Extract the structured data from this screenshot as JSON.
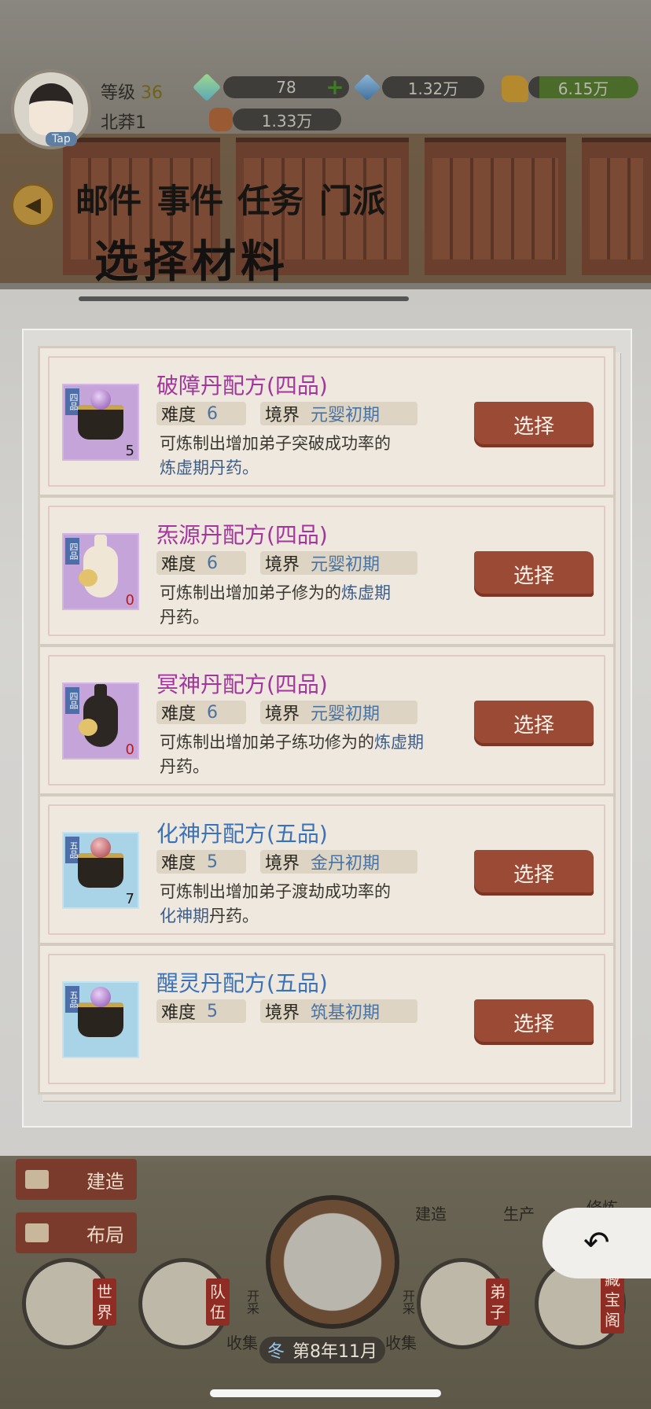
{
  "status_bar": {
    "level_label": "等级",
    "level_value": "36",
    "sect_name": "北莽1",
    "tap_label": "Tap",
    "resources": [
      {
        "icon": "green-jade-icon",
        "value": "78"
      },
      {
        "icon": "blue-crystal-icon",
        "value": "1.32万"
      },
      {
        "icon": "gold-ingot-icon",
        "value": "6.15万"
      },
      {
        "icon": "fist-icon",
        "value": "1.33万"
      }
    ]
  },
  "top_nav": {
    "items": [
      "邮件",
      "事件",
      "任务",
      "门派"
    ]
  },
  "panel": {
    "title": "选择材料"
  },
  "recipes": [
    {
      "name": "破障丹配方(四品)",
      "grade": "四品",
      "count": "5",
      "difficulty_label": "难度",
      "difficulty": "6",
      "realm_label": "境界",
      "realm": "元婴初期",
      "desc": "可炼制出增加弟子突破成功率的",
      "desc_hl": "炼虚期丹药。",
      "button": "选择"
    },
    {
      "name": "炁源丹配方(四品)",
      "grade": "四品",
      "count": "0",
      "difficulty_label": "难度",
      "difficulty": "6",
      "realm_label": "境界",
      "realm": "元婴初期",
      "desc": "可炼制出增加弟子修为的",
      "desc_hl": "炼虚期",
      "desc_tail": "丹药。",
      "button": "选择"
    },
    {
      "name": "冥神丹配方(四品)",
      "grade": "四品",
      "count": "0",
      "difficulty_label": "难度",
      "difficulty": "6",
      "realm_label": "境界",
      "realm": "元婴初期",
      "desc": "可炼制出增加弟子练功修为的",
      "desc_hl": "炼虚期",
      "desc_tail": "丹药。",
      "button": "选择"
    },
    {
      "name": "化神丹配方(五品)",
      "grade": "五品",
      "count": "7",
      "difficulty_label": "难度",
      "difficulty": "5",
      "realm_label": "境界",
      "realm": "金丹初期",
      "desc": "可炼制出增加弟子渡劫成功率的",
      "desc_hl": "化神期",
      "desc_tail": "丹药。",
      "button": "选择"
    },
    {
      "name": "醒灵丹配方(五品)",
      "grade": "五品",
      "difficulty_label": "难度",
      "difficulty": "5",
      "realm_label": "境界",
      "realm": "筑基初期",
      "button": "选择"
    }
  ],
  "bottom": {
    "build_chip": "建造",
    "layout_chip": "布局",
    "build_small": "建造",
    "produce_small": "生产",
    "cultivate_small": "修炼",
    "world_label": "世界",
    "team_label": "队伍",
    "disciple_label": "弟子",
    "treasure_label": "藏宝阁",
    "open_left": "开采",
    "open_right": "开采",
    "collect_left": "收集",
    "collect_right": "收集",
    "season": "冬",
    "date": "第8年11月"
  },
  "colors": {
    "four_grade": "#a2369c",
    "five_grade": "#3a72b8",
    "select_button": "#9a4a35"
  }
}
